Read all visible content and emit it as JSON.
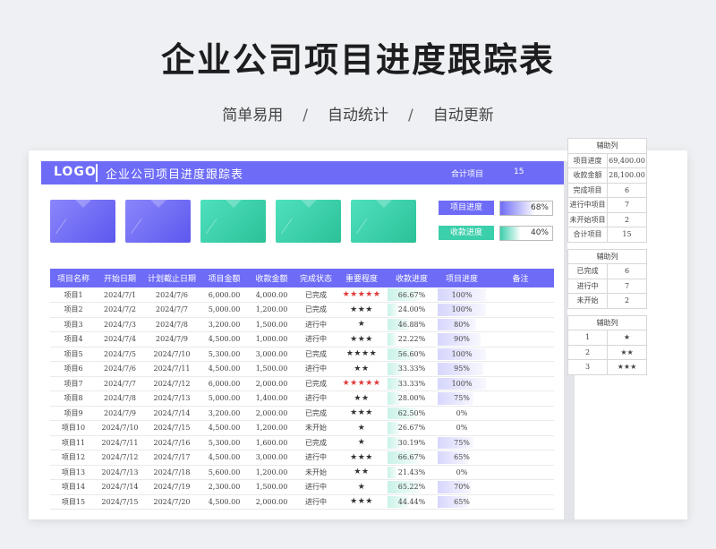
{
  "page": {
    "title": "企业公司项目进度跟踪表",
    "subtitle": [
      "简单易用",
      "自动统计",
      "自动更新"
    ],
    "separator": "/"
  },
  "sheet": {
    "logo": "LOGO",
    "title": "企业公司项目进度跟踪表",
    "total_label": "合计项目",
    "total_value": "15",
    "progress": [
      {
        "label": "项目进度",
        "value": "68%",
        "fraction": 0.68,
        "color": "#6e6cf6"
      },
      {
        "label": "收款进度",
        "value": "40%",
        "fraction": 0.4,
        "color": "#3ccfab"
      }
    ],
    "cards": [
      "blue",
      "blue",
      "green",
      "green",
      "green"
    ]
  },
  "table": {
    "headers": [
      "项目名称",
      "开始日期",
      "计划截止日期",
      "项目金额",
      "收款金额",
      "完成状态",
      "重要程度",
      "收款进度",
      "项目进度",
      "备注"
    ],
    "rows": [
      [
        "项目1",
        "2024/7/1",
        "2024/7/6",
        "6,000.00",
        "4,000.00",
        "已完成",
        "★★★★★",
        "66.67%",
        "100%",
        "",
        "red"
      ],
      [
        "项目2",
        "2024/7/2",
        "2024/7/7",
        "5,000.00",
        "1,200.00",
        "已完成",
        "★★★",
        "24.00%",
        "100%",
        "",
        ""
      ],
      [
        "项目3",
        "2024/7/3",
        "2024/7/8",
        "3,200.00",
        "1,500.00",
        "进行中",
        "★",
        "46.88%",
        "80%",
        "",
        ""
      ],
      [
        "项目4",
        "2024/7/4",
        "2024/7/9",
        "4,500.00",
        "1,000.00",
        "进行中",
        "★★★",
        "22.22%",
        "90%",
        "",
        ""
      ],
      [
        "项目5",
        "2024/7/5",
        "2024/7/10",
        "5,300.00",
        "3,000.00",
        "已完成",
        "★★★★",
        "56.60%",
        "100%",
        "",
        ""
      ],
      [
        "项目6",
        "2024/7/6",
        "2024/7/11",
        "4,500.00",
        "1,500.00",
        "进行中",
        "★★",
        "33.33%",
        "95%",
        "",
        ""
      ],
      [
        "项目7",
        "2024/7/7",
        "2024/7/12",
        "6,000.00",
        "2,000.00",
        "已完成",
        "★★★★★",
        "33.33%",
        "100%",
        "",
        "red"
      ],
      [
        "项目8",
        "2024/7/8",
        "2024/7/13",
        "5,000.00",
        "1,400.00",
        "进行中",
        "★★",
        "28.00%",
        "75%",
        "",
        ""
      ],
      [
        "项目9",
        "2024/7/9",
        "2024/7/14",
        "3,200.00",
        "2,000.00",
        "已完成",
        "★★★",
        "62.50%",
        "0%",
        "",
        ""
      ],
      [
        "项目10",
        "2024/7/10",
        "2024/7/15",
        "4,500.00",
        "1,200.00",
        "未开始",
        "★",
        "26.67%",
        "0%",
        "",
        ""
      ],
      [
        "项目11",
        "2024/7/11",
        "2024/7/16",
        "5,300.00",
        "1,600.00",
        "已完成",
        "★",
        "30.19%",
        "75%",
        "",
        ""
      ],
      [
        "项目12",
        "2024/7/12",
        "2024/7/17",
        "4,500.00",
        "3,000.00",
        "进行中",
        "★★★",
        "66.67%",
        "65%",
        "",
        ""
      ],
      [
        "项目13",
        "2024/7/13",
        "2024/7/18",
        "5,600.00",
        "1,200.00",
        "未开始",
        "★★",
        "21.43%",
        "0%",
        "",
        ""
      ],
      [
        "项目14",
        "2024/7/14",
        "2024/7/19",
        "2,300.00",
        "1,500.00",
        "进行中",
        "★",
        "65.22%",
        "70%",
        "",
        ""
      ],
      [
        "项目15",
        "2024/7/15",
        "2024/7/20",
        "4,500.00",
        "2,000.00",
        "进行中",
        "★★★",
        "44.44%",
        "65%",
        "",
        ""
      ]
    ]
  },
  "helper": {
    "section1_title": "辅助列",
    "section1": [
      [
        "项目进度",
        "69,400.00"
      ],
      [
        "收款金额",
        "28,100.00"
      ],
      [
        "完成项目",
        "6"
      ],
      [
        "进行中项目",
        "7"
      ],
      [
        "未开始项目",
        "2"
      ],
      [
        "合计项目",
        "15"
      ]
    ],
    "section2_title": "辅助列",
    "section2": [
      [
        "已完成",
        "6"
      ],
      [
        "进行中",
        "7"
      ],
      [
        "未开始",
        "2"
      ]
    ],
    "section3_title": "辅助列",
    "section3": [
      [
        "1",
        "★"
      ],
      [
        "2",
        "★★"
      ],
      [
        "3",
        "★★★"
      ]
    ]
  }
}
